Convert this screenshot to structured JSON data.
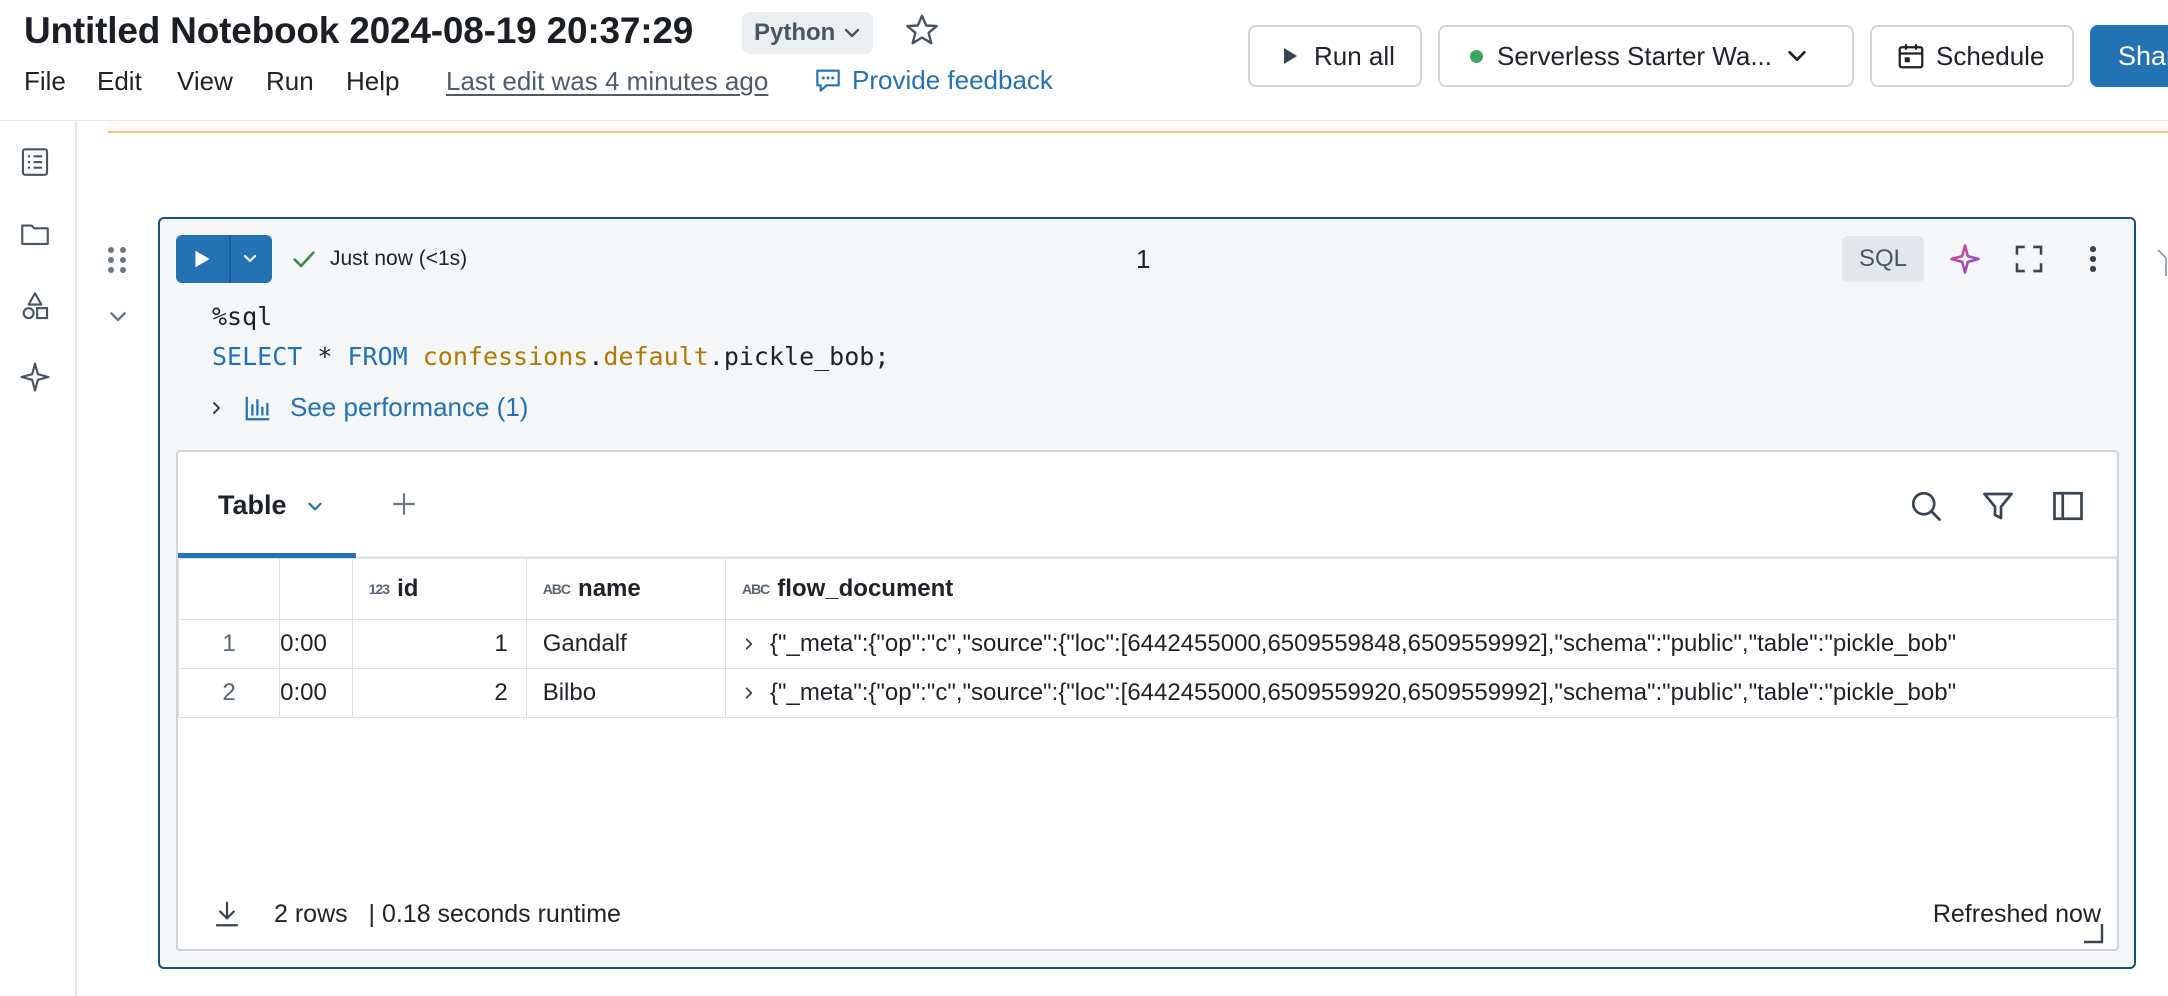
{
  "header": {
    "title": "Untitled Notebook 2024-08-19 20:37:29",
    "language": "Python",
    "menus": [
      "File",
      "Edit",
      "View",
      "Run",
      "Help"
    ],
    "last_edit": "Last edit was 4 minutes ago",
    "feedback": "Provide feedback",
    "run_all": "Run all",
    "compute": "Serverless Starter Wa...",
    "compute_status_color": "#3ba55c",
    "schedule": "Schedule",
    "share": "Shar"
  },
  "cell": {
    "status": "Just now (<1s)",
    "number": "1",
    "language_badge": "SQL",
    "code": {
      "magic": "%sql",
      "kw_select": "SELECT",
      "star": " * ",
      "kw_from": "FROM",
      "catalog": "confessions",
      "schema": "default",
      "table": "pickle_bob;"
    },
    "performance": "See performance (1)"
  },
  "results": {
    "tab": "Table",
    "columns": [
      {
        "name": "",
        "type": ""
      },
      {
        "name": "",
        "type": ""
      },
      {
        "name": "id",
        "type": "123"
      },
      {
        "name": "name",
        "type": "ABC"
      },
      {
        "name": "flow_document",
        "type": "ABC"
      }
    ],
    "rows": [
      {
        "row": "1",
        "time": "0:00",
        "id": "1",
        "name": "Gandalf",
        "flow_document": "{\"_meta\":{\"op\":\"c\",\"source\":{\"loc\":[6442455000,6509559848,6509559992],\"schema\":\"public\",\"table\":\"pickle_bob\""
      },
      {
        "row": "2",
        "time": "0:00",
        "id": "2",
        "name": "Bilbo",
        "flow_document": "{\"_meta\":{\"op\":\"c\",\"source\":{\"loc\":[6442455000,6509559920,6509559992],\"schema\":\"public\",\"table\":\"pickle_bob\""
      }
    ],
    "footer": {
      "rows": "2 rows",
      "separator": "|",
      "runtime": "0.18 seconds runtime",
      "refreshed": "Refreshed now"
    }
  },
  "colors": {
    "accent": "#2272b4",
    "cell_border": "#1c4f7a",
    "success": "#3b8a4f"
  },
  "icons": [
    "star-icon",
    "speech-bubble-icon",
    "play-icon",
    "chevron-down-icon",
    "calendar-icon",
    "toc-icon",
    "folder-icon",
    "shapes-icon",
    "sparkle-icon",
    "drag-handle-icon",
    "check-icon",
    "expand-icon",
    "kebab-icon",
    "bar-chart-icon",
    "chevron-right-icon",
    "plus-icon",
    "search-icon",
    "filter-icon",
    "sidebar-panel-icon",
    "download-icon",
    "resize-corner-icon"
  ]
}
